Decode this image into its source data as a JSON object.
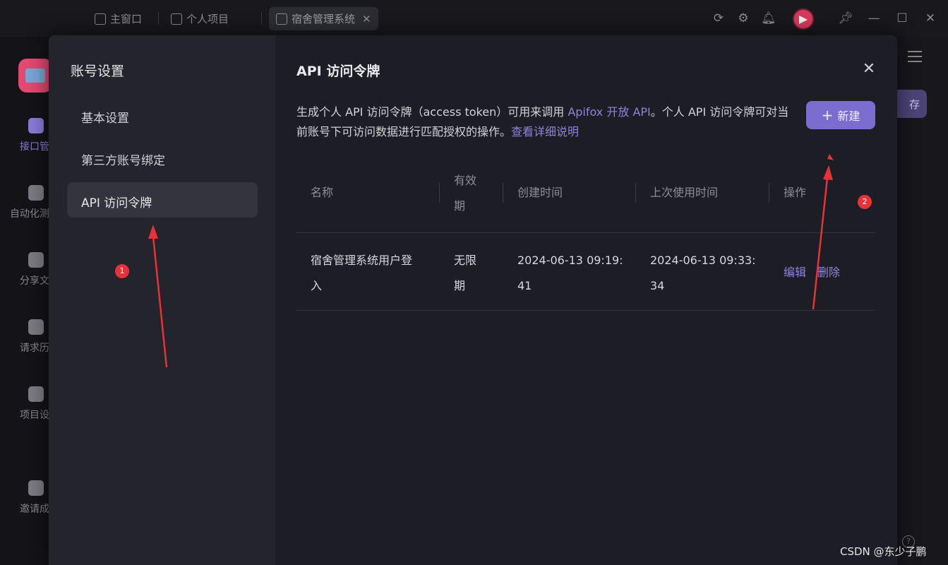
{
  "titlebar": {
    "tabs": [
      {
        "label": "主窗口",
        "icon": "home-icon"
      },
      {
        "label": "个人项目",
        "icon": "external-link-icon"
      },
      {
        "label": "宿舍管理系统",
        "icon": "external-link-icon",
        "close": "✕"
      }
    ],
    "icons": [
      "refresh-icon",
      "settings-icon",
      "bell-icon",
      "avatar",
      "pin-icon",
      "minimize-icon",
      "maximize-icon",
      "close-icon"
    ],
    "window_controls": {
      "minimize": "—",
      "maximize": "☐",
      "close": "✕"
    }
  },
  "rail": {
    "items": [
      {
        "label": "接口管",
        "icon": "api-icon"
      },
      {
        "label": "自动化测",
        "icon": "automation-icon"
      },
      {
        "label": "分享文",
        "icon": "share-doc-icon"
      },
      {
        "label": "请求历",
        "icon": "history-icon"
      },
      {
        "label": "项目设",
        "icon": "project-settings-icon"
      },
      {
        "label": "邀请成",
        "icon": "invite-user-icon"
      }
    ],
    "save_fragment": "存"
  },
  "modal": {
    "sidebar": {
      "title": "账号设置",
      "items": [
        "基本设置",
        "第三方账号绑定",
        "API 访问令牌"
      ]
    },
    "title": "API 访问令牌",
    "close": "✕",
    "description": {
      "part1": "生成个人 API 访问令牌（access token）可用来调用 ",
      "link1": "Apifox 开放 API",
      "part2": "。个人 API 访问令牌可对当前账号下可访问数据进行匹配授权的操作。",
      "link2": "查看详细说明"
    },
    "new_button": {
      "plus": "+",
      "label": "新建"
    },
    "table": {
      "headers": {
        "name": "名称",
        "validity_l1": "有效",
        "validity_l2": "期",
        "created": "创建时间",
        "last_used": "上次使用时间",
        "actions": "操作"
      },
      "rows": [
        {
          "name_l1": "宿舍管理系统用户登",
          "name_l2": "入",
          "validity_l1": "无限",
          "validity_l2": "期",
          "created_l1": "2024-06-13 09:19:",
          "created_l2": "41",
          "last_used_l1": "2024-06-13 09:33:",
          "last_used_l2": "34",
          "edit": "编辑",
          "delete": "删除"
        }
      ]
    }
  },
  "annotations": {
    "badge1": "1",
    "badge2": "2",
    "color": "#e8323a"
  },
  "footer": {
    "watermark": "CSDN @东少子鹏",
    "help": "?"
  }
}
